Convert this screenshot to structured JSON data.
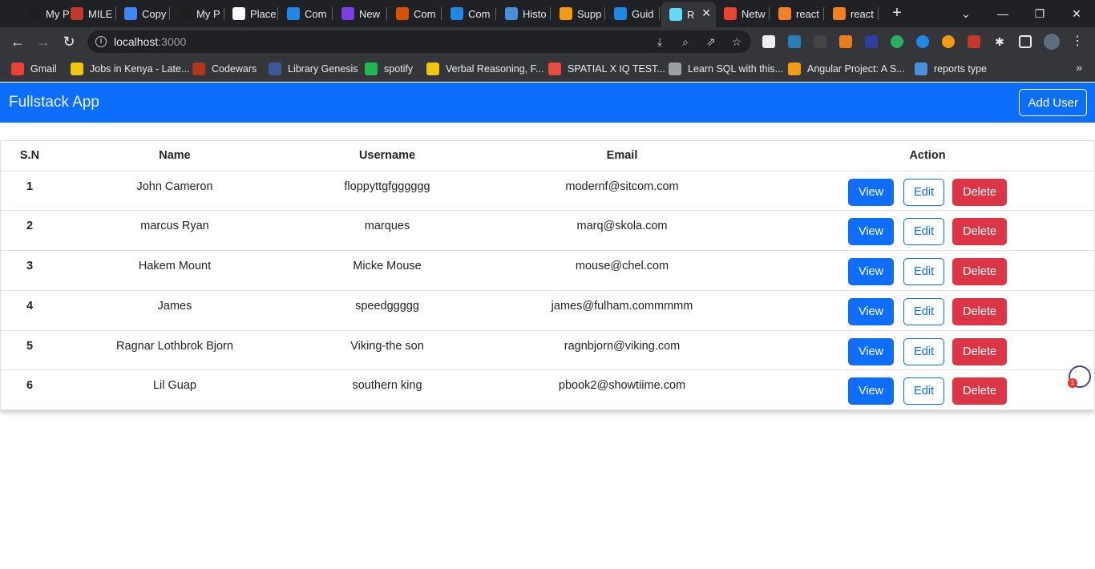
{
  "browser": {
    "tabs": [
      {
        "label": "My P",
        "icon": "page-icon",
        "color": "#1f1f1f"
      },
      {
        "label": "MILE",
        "icon": "spinner-icon",
        "color": "#c0392b"
      },
      {
        "label": "Copy",
        "icon": "docs-icon",
        "color": "#4285f4"
      },
      {
        "label": "My P",
        "icon": "page-icon",
        "color": "#1f1f1f"
      },
      {
        "label": "Place",
        "icon": "page-icon",
        "color": "#ffffff"
      },
      {
        "label": "Com",
        "icon": "edge-icon",
        "color": "#1e88e5"
      },
      {
        "label": "New",
        "icon": "app-icon",
        "color": "#7b3fe4"
      },
      {
        "label": "Com",
        "icon": "briefcase-icon",
        "color": "#d35400"
      },
      {
        "label": "Com",
        "icon": "edge-icon",
        "color": "#1e88e5"
      },
      {
        "label": "Histo",
        "icon": "history-icon",
        "color": "#4a90d9"
      },
      {
        "label": "Supp",
        "icon": "tools-icon",
        "color": "#f39c12"
      },
      {
        "label": "Guid",
        "icon": "edge-icon",
        "color": "#1e88e5"
      },
      {
        "label": "R",
        "icon": "react-icon",
        "color": "#61dafb"
      },
      {
        "label": "Netw",
        "icon": "google-icon",
        "color": "#ea4335"
      },
      {
        "label": "react",
        "icon": "stackoverflow-icon",
        "color": "#f48024"
      },
      {
        "label": "react",
        "icon": "stackoverflow-icon",
        "color": "#f48024"
      }
    ],
    "active_tab_index": 12,
    "url_host": "localhost",
    "url_port": ":3000",
    "bookmarks": [
      {
        "label": "Gmail",
        "icon": "gmail-icon",
        "color": "#ea4335"
      },
      {
        "label": "Jobs in Kenya - Late...",
        "icon": "fuzu-icon",
        "color": "#f1c40f"
      },
      {
        "label": "Codewars",
        "icon": "codewars-icon",
        "color": "#b1361e"
      },
      {
        "label": "Library Genesis",
        "icon": "library-icon",
        "color": "#3b5998"
      },
      {
        "label": "spotify",
        "icon": "spotify-icon",
        "color": "#1db954"
      },
      {
        "label": "Verbal Reasoning, F...",
        "icon": "triangle-icon",
        "color": "#f1c40f"
      },
      {
        "label": "SPATIAL X IQ TEST...",
        "icon": "image-icon",
        "color": "#e74c3c"
      },
      {
        "label": "Learn SQL with this...",
        "icon": "globe-icon",
        "color": "#9aa0a6"
      },
      {
        "label": "Angular Project: A S...",
        "icon": "bolt-icon",
        "color": "#f39c12"
      },
      {
        "label": "reports type",
        "icon": "person-icon",
        "color": "#4a90d9"
      }
    ]
  },
  "app": {
    "brand": "Fullstack App",
    "add_user_label": "Add User",
    "columns": [
      "S.N",
      "Name",
      "Username",
      "Email",
      "Action"
    ],
    "users": [
      {
        "sn": "1",
        "name": "John Cameron",
        "username": "floppyttgfgggggg",
        "email": "modernf@sitcom.com"
      },
      {
        "sn": "2",
        "name": "marcus Ryan",
        "username": "marques",
        "email": "marq@skola.com"
      },
      {
        "sn": "3",
        "name": "Hakem Mount",
        "username": "Micke Mouse",
        "email": "mouse@chel.com"
      },
      {
        "sn": "4",
        "name": "James",
        "username": "speedggggg",
        "email": "james@fulham.commmmm"
      },
      {
        "sn": "5",
        "name": "Ragnar Lothbrok Bjorn",
        "username": "Viking-the son",
        "email": "ragnbjorn@viking.com"
      },
      {
        "sn": "6",
        "name": "Lil Guap",
        "username": "southern king",
        "email": "pbook2@showtiime.com"
      }
    ],
    "actions": {
      "view": "View",
      "edit": "Edit",
      "delete": "Delete"
    },
    "helper_badge": "1"
  }
}
